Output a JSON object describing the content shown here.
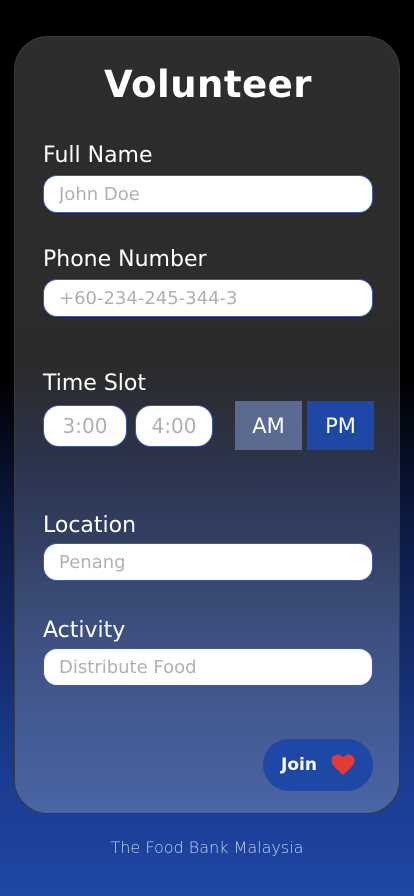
{
  "form": {
    "title": "Volunteer",
    "full_name": {
      "label": "Full Name",
      "placeholder": "John Doe"
    },
    "phone": {
      "label": "Phone Number",
      "placeholder": "+60-234-245-344-3"
    },
    "time_slot": {
      "label": "Time Slot",
      "start_placeholder": "3:00",
      "end_placeholder": "4:00",
      "am_label": "AM",
      "pm_label": "PM",
      "selected": "PM"
    },
    "location": {
      "label": "Location",
      "placeholder": "Penang"
    },
    "activity": {
      "label": "Activity",
      "placeholder": "Distribute Food"
    },
    "join_button": {
      "label": "Join",
      "icon": "heart-icon"
    }
  },
  "footer": {
    "text": "The Food Bank Malaysia"
  },
  "colors": {
    "accent": "#1f47a6",
    "am_button": "#5a6a90",
    "heart": "#e53935",
    "card": "#2d2d2d"
  }
}
